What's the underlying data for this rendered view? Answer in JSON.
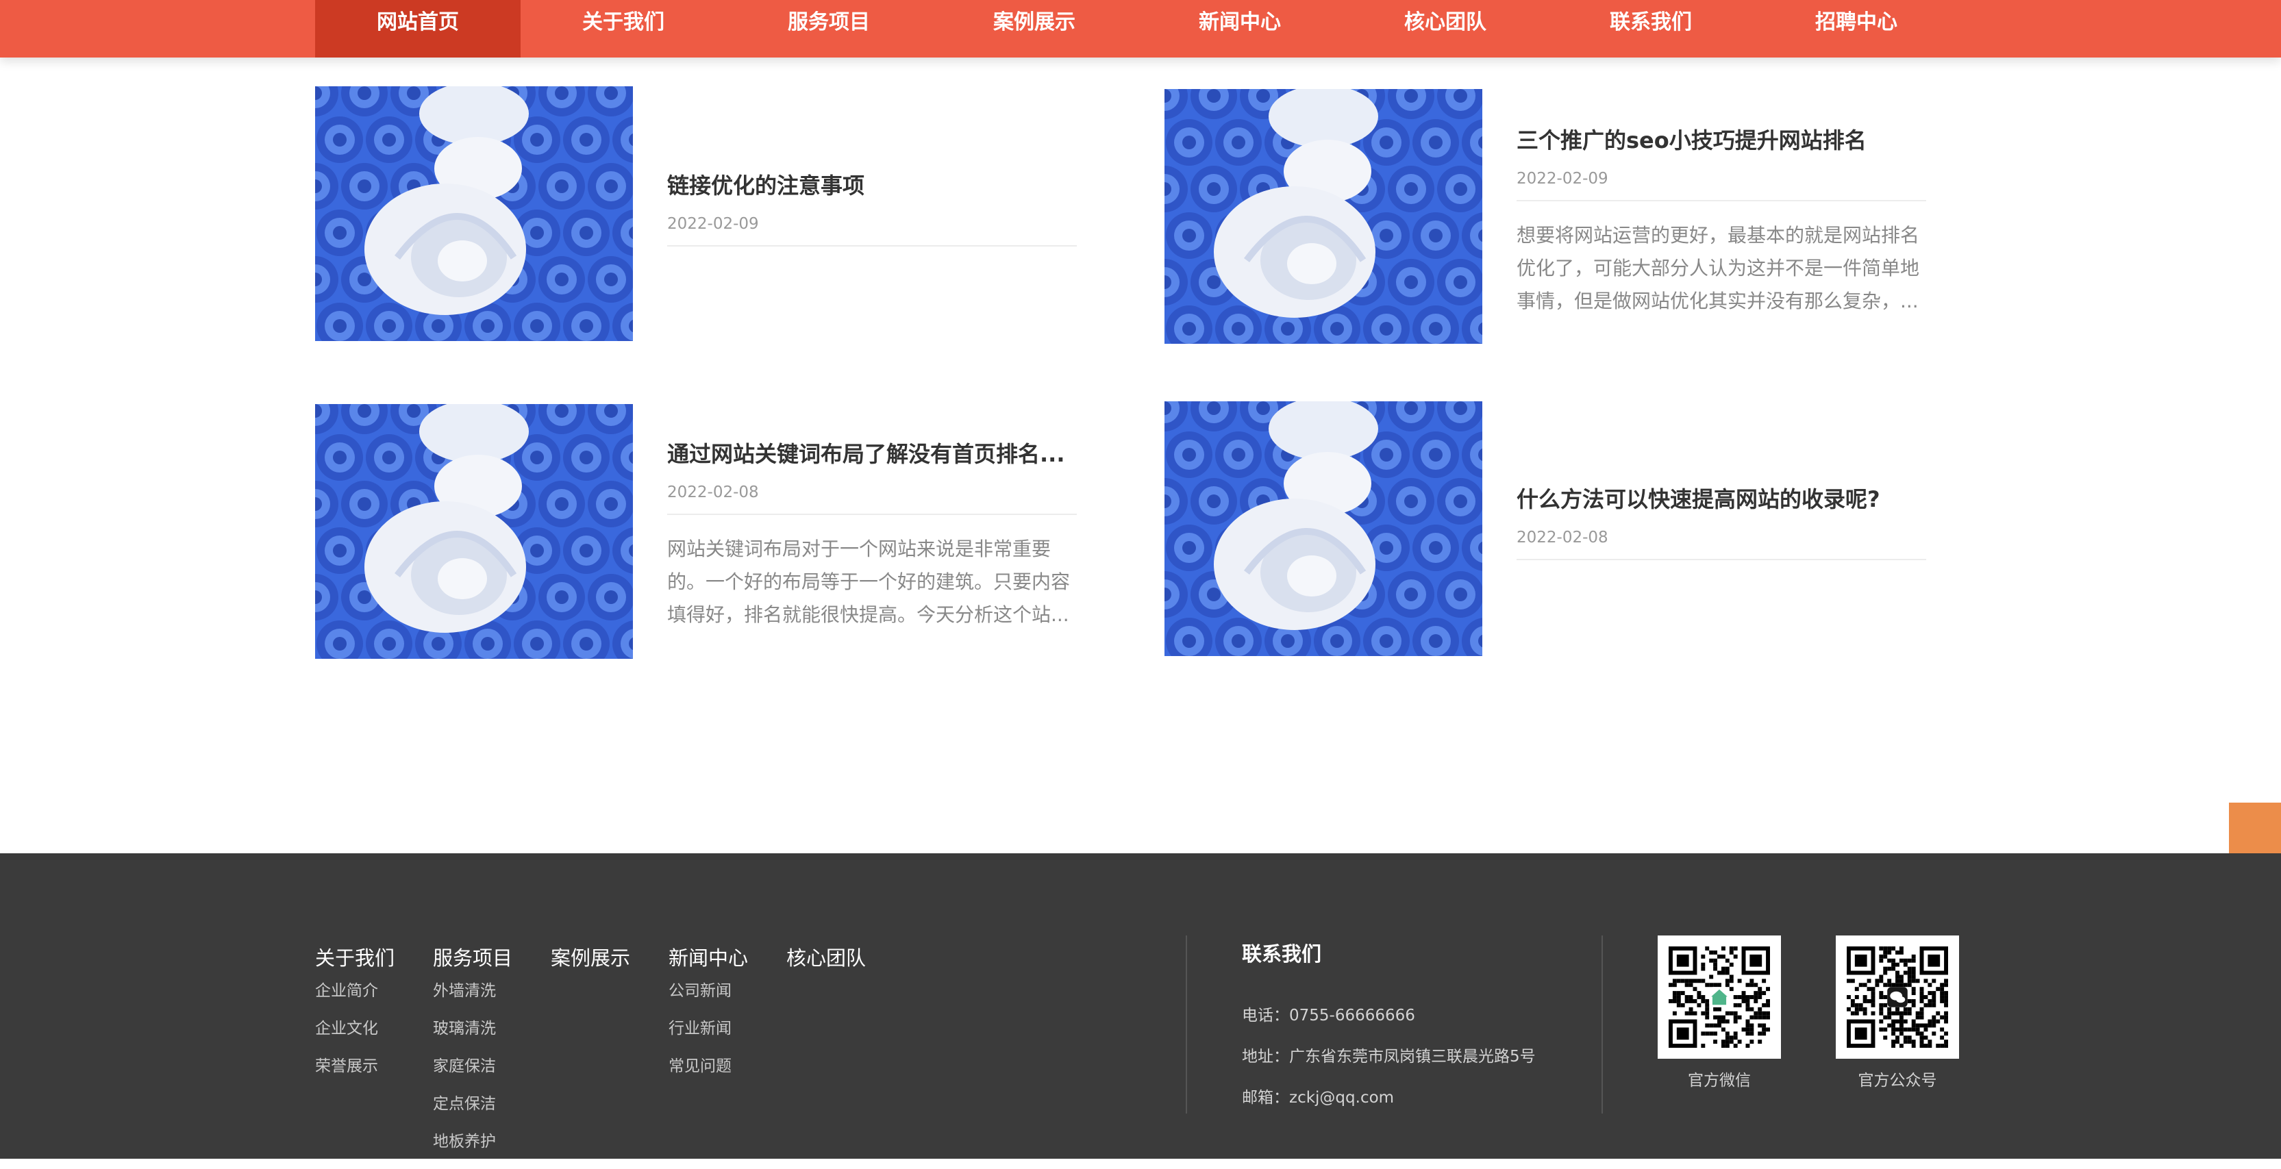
{
  "nav": {
    "items": [
      "网站首页",
      "关于我们",
      "服务项目",
      "案例展示",
      "新闻中心",
      "核心团队",
      "联系我们",
      "招聘中心"
    ],
    "active_index": 0
  },
  "news": [
    {
      "title": "链接优化的注意事项",
      "date": "2022-02-09",
      "excerpt": []
    },
    {
      "title": "三个推广的seo小技巧提升网站排名",
      "date": "2022-02-09",
      "excerpt": [
        "想要将网站运营的更好，最基本的就是网站排名",
        "优化了，可能大部分人认为这并不是一件简单地",
        "事情，但是做网站优化其实并没有那么复杂，..."
      ]
    },
    {
      "title": "通过网站关键词布局了解没有首页排名...",
      "date": "2022-02-08",
      "excerpt": [
        "网站关键词布局对于一个网站来说是非常重要",
        "的。一个好的布局等于一个好的建筑。只要内容",
        "填得好，排名就能很快提高。今天分析这个站..."
      ]
    },
    {
      "title": "什么方法可以快速提高网站的收录呢?",
      "date": "2022-02-08",
      "excerpt": []
    }
  ],
  "footer": {
    "columns": [
      {
        "title": "关于我们",
        "links": [
          "企业简介",
          "企业文化",
          "荣誉展示"
        ]
      },
      {
        "title": "服务项目",
        "links": [
          "外墙清洗",
          "玻璃清洗",
          "家庭保洁",
          "定点保洁",
          "地板养护"
        ]
      },
      {
        "title": "案例展示",
        "links": []
      },
      {
        "title": "新闻中心",
        "links": [
          "公司新闻",
          "行业新闻",
          "常见问题"
        ]
      },
      {
        "title": "核心团队",
        "links": []
      }
    ],
    "contact": {
      "title": "联系我们",
      "phone": "电话：0755-66666666",
      "address": "地址：广东省东莞市凤岗镇三联晨光路5号",
      "email": "邮箱：zckj@qq.com"
    },
    "qr": [
      {
        "caption": "官方微信",
        "icon": "wechat-home-icon"
      },
      {
        "caption": "官方公众号",
        "icon": "wechat-icon"
      }
    ]
  },
  "colors": {
    "nav_bg": "#ee5b44",
    "nav_active": "#cc3a23",
    "footer_bg": "#3b3b3b",
    "side_button": "#ec8d4a"
  }
}
